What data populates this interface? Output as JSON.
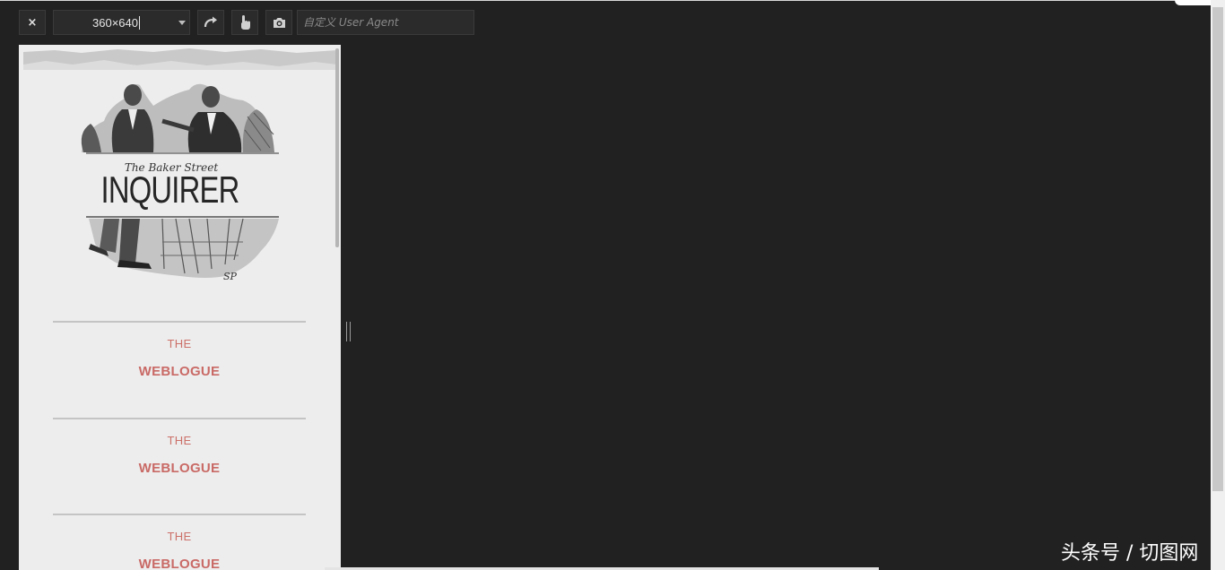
{
  "toolbar": {
    "close_label": "×",
    "size_value": "360×640",
    "ua_placeholder": "自定义 User Agent"
  },
  "icons": {
    "close": "close-icon",
    "dropdown": "chevron-down-icon",
    "rotate": "rotate-icon",
    "touch": "touch-hand-icon",
    "screenshot": "camera-icon"
  },
  "device_page": {
    "masthead": {
      "subtitle": "The Baker Street",
      "title": "INQUIRER",
      "signature": "SP"
    },
    "posts": [
      {
        "pre": "THE",
        "title": "WEBLOGUE"
      },
      {
        "pre": "THE",
        "title": "WEBLOGUE"
      },
      {
        "pre": "THE",
        "title": "WEBLOGUE"
      }
    ]
  },
  "watermark": "头条号 / 切图网",
  "colors": {
    "background": "#212121",
    "accent": "#c96a66",
    "device_bg": "#ededed"
  }
}
